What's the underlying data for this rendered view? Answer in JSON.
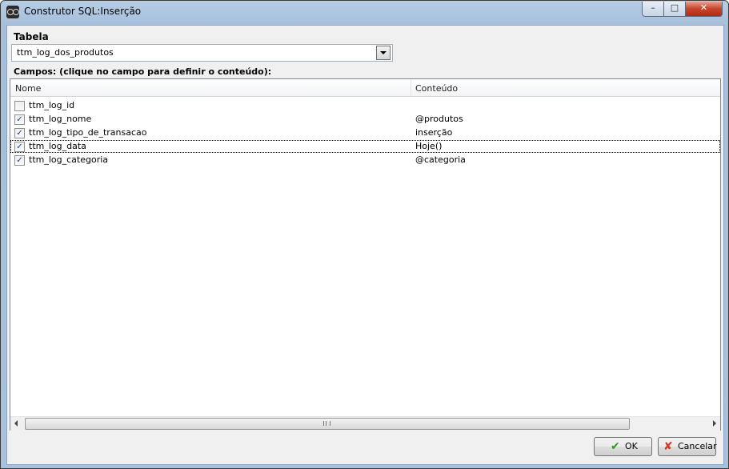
{
  "window": {
    "title": "Construtor SQL:Inserção",
    "app_icon": "sql-builder-icon",
    "controls": {
      "minimize": "–",
      "maximize": "□",
      "close": "✕"
    }
  },
  "table_section": {
    "label": "Tabela",
    "selected": "ttm_log_dos_produtos"
  },
  "fields_section": {
    "label": "Campos: (clique no campo para definir o conteúdo):",
    "columns": {
      "name": "Nome",
      "content": "Conteúdo"
    },
    "rows": [
      {
        "checked": false,
        "name": "ttm_log_id",
        "content": ""
      },
      {
        "checked": true,
        "name": "ttm_log_nome",
        "content": "@produtos"
      },
      {
        "checked": true,
        "name": "ttm_log_tipo_de_transacao",
        "content": "inserção"
      },
      {
        "checked": true,
        "name": "ttm_log_data",
        "content": "Hoje()",
        "focused": true
      },
      {
        "checked": true,
        "name": "ttm_log_categoria",
        "content": "@categoria"
      }
    ]
  },
  "buttons": {
    "ok": "OK",
    "cancel": "Cancelar"
  },
  "icons": {
    "ok": "checkmark-icon",
    "cancel": "x-icon"
  }
}
